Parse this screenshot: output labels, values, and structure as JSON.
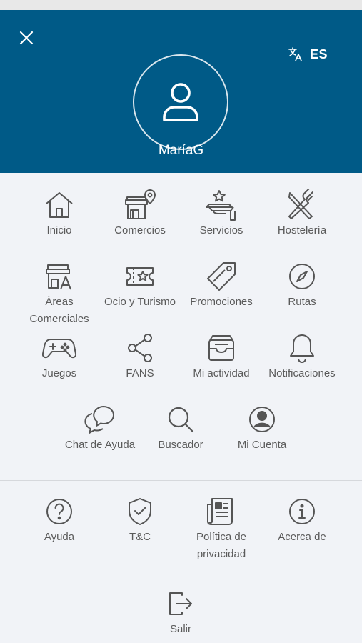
{
  "header": {
    "lang_code": "ES",
    "username": "MaríaG",
    "close_icon": "close-icon",
    "translate_icon": "translate-icon",
    "avatar_icon": "user-icon"
  },
  "menu": {
    "row1": [
      {
        "label": "Inicio",
        "icon": "home-icon"
      },
      {
        "label": "Comercios",
        "icon": "store-location-icon"
      },
      {
        "label": "Servicios",
        "icon": "service-tray-icon"
      },
      {
        "label": "Hostelería",
        "icon": "utensils-icon"
      }
    ],
    "row2": [
      {
        "label": "Áreas Comerciales",
        "icon": "store-area-icon"
      },
      {
        "label": "Ocio y Turismo",
        "icon": "ticket-icon"
      },
      {
        "label": "Promociones",
        "icon": "tag-icon"
      },
      {
        "label": "Rutas",
        "icon": "compass-icon"
      }
    ],
    "row3": [
      {
        "label": "Juegos",
        "icon": "gamepad-icon"
      },
      {
        "label": "FANS",
        "icon": "share-icon"
      },
      {
        "label": "Mi actividad",
        "icon": "inbox-icon"
      },
      {
        "label": "Notificaciones",
        "icon": "bell-icon"
      }
    ],
    "row4": [
      {
        "label": "Chat de Ayuda",
        "icon": "chat-icon"
      },
      {
        "label": "Buscador",
        "icon": "search-icon"
      },
      {
        "label": "Mi Cuenta",
        "icon": "account-icon"
      }
    ]
  },
  "info": [
    {
      "label": "Ayuda",
      "icon": "help-icon"
    },
    {
      "label": "T&C",
      "icon": "shield-check-icon"
    },
    {
      "label": "Política de privacidad",
      "icon": "newspaper-icon"
    },
    {
      "label": "Acerca de",
      "icon": "info-icon"
    }
  ],
  "logout": {
    "label": "Salir",
    "icon": "logout-icon"
  },
  "colors": {
    "header_bg": "#005a87",
    "background": "#f1f3f7",
    "icon": "#555555"
  }
}
